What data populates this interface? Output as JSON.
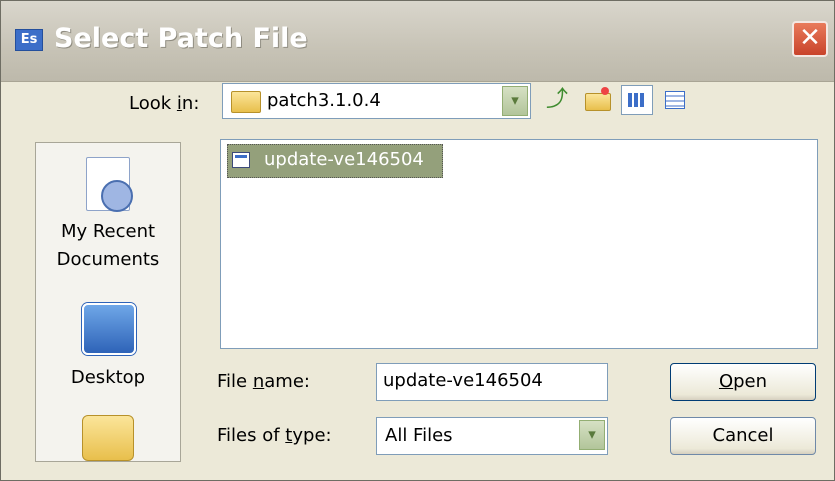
{
  "window": {
    "title": "Select Patch File",
    "title_icon_glyph": "Es",
    "close_glyph": "✕"
  },
  "look_in": {
    "label_pre": "Look ",
    "label_u": "i",
    "label_post": "n:",
    "value": "patch3.1.0.4"
  },
  "toolbar": {
    "icons": [
      "up-folder-icon",
      "new-folder-icon",
      "views-icon",
      "details-view-icon"
    ]
  },
  "places": [
    {
      "label_line1": "My Recent",
      "label_line2": "Documents",
      "icon": "recent-documents-icon"
    },
    {
      "label_line1": "Desktop",
      "label_line2": "",
      "icon": "desktop-icon"
    },
    {
      "label_line1": "",
      "label_line2": "",
      "icon": "my-documents-icon"
    }
  ],
  "file_list": {
    "items": [
      {
        "name": "update-ve146504",
        "selected": true
      }
    ]
  },
  "file_name": {
    "label_pre": "File ",
    "label_u": "n",
    "label_post": "ame:",
    "value": "update-ve146504"
  },
  "file_type": {
    "label_pre": "Files of ",
    "label_u": "t",
    "label_post": "ype:",
    "value": "All Files"
  },
  "buttons": {
    "open_u": "O",
    "open_rest": "pen",
    "cancel": "Cancel"
  },
  "colors": {
    "title_bar": "#c7c3b6",
    "dialog_bg": "#ece9d8",
    "selection": "#94a07b",
    "close_button": "#c9432b"
  }
}
